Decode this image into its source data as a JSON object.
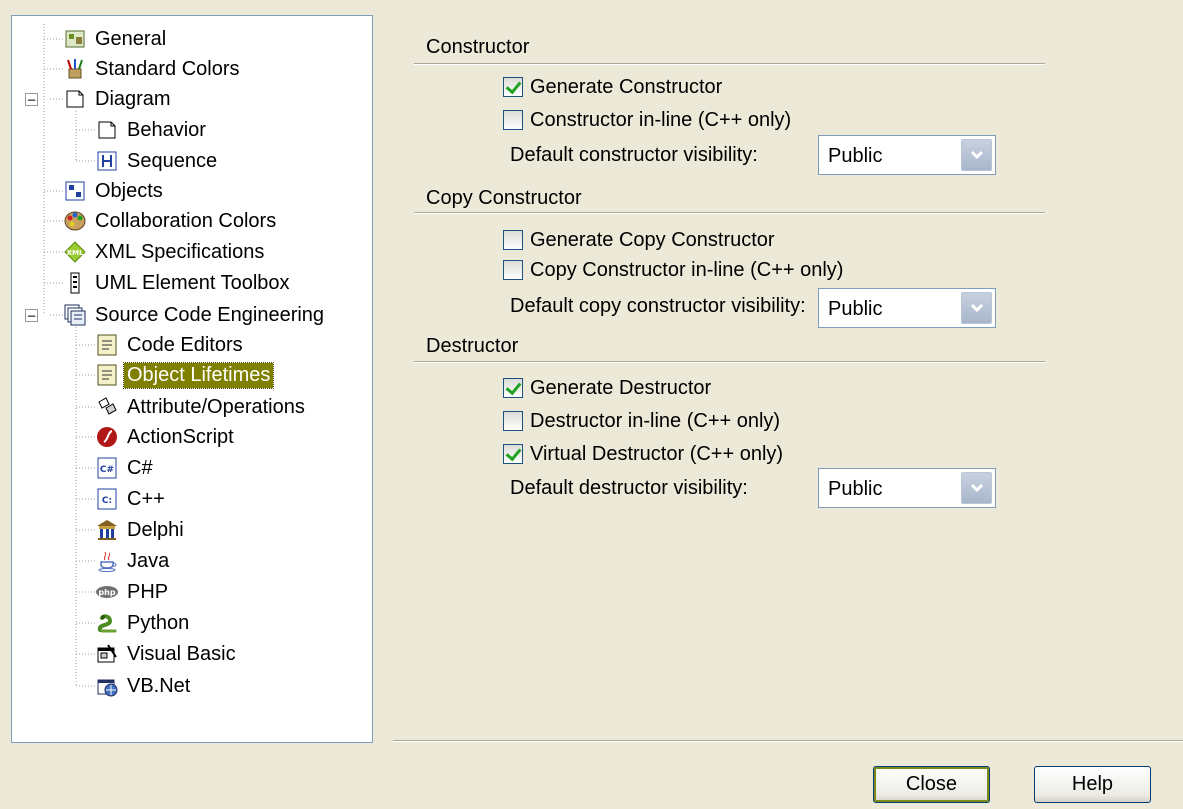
{
  "tree": {
    "items": [
      {
        "label": "General",
        "icon": "general-icon"
      },
      {
        "label": "Standard Colors",
        "icon": "paint-brushes-icon"
      },
      {
        "label": "Diagram",
        "icon": "diagram-page-icon"
      },
      {
        "label": "Behavior",
        "icon": "page-icon"
      },
      {
        "label": "Sequence",
        "icon": "sequence-icon"
      },
      {
        "label": "Objects",
        "icon": "objects-icon"
      },
      {
        "label": "Collaboration Colors",
        "icon": "palette-icon"
      },
      {
        "label": "XML Specifications",
        "icon": "xml-icon"
      },
      {
        "label": "UML Element Toolbox",
        "icon": "toolbox-icon"
      },
      {
        "label": "Source Code Engineering",
        "icon": "source-code-icon"
      },
      {
        "label": "Code Editors",
        "icon": "code-editor-icon"
      },
      {
        "label": "Object Lifetimes",
        "icon": "code-editor-icon"
      },
      {
        "label": "Attribute/Operations",
        "icon": "attribute-operations-icon"
      },
      {
        "label": "ActionScript",
        "icon": "actionscript-icon"
      },
      {
        "label": "C#",
        "icon": "csharp-icon"
      },
      {
        "label": "C++",
        "icon": "cplusplus-icon"
      },
      {
        "label": "Delphi",
        "icon": "delphi-icon"
      },
      {
        "label": "Java",
        "icon": "java-icon"
      },
      {
        "label": "PHP",
        "icon": "php-icon"
      },
      {
        "label": "Python",
        "icon": "python-icon"
      },
      {
        "label": "Visual Basic",
        "icon": "visual-basic-icon"
      },
      {
        "label": "VB.Net",
        "icon": "vbnet-icon"
      }
    ],
    "selected": "Object Lifetimes",
    "expander_symbols": {
      "expanded": "−"
    }
  },
  "constructor": {
    "title": "Constructor",
    "generate_label": "Generate Constructor",
    "generate_checked": true,
    "inline_label": "Constructor in-line (C++ only)",
    "inline_checked": false,
    "visibility_label": "Default constructor visibility:",
    "visibility_value": "Public"
  },
  "copy_constructor": {
    "title": "Copy Constructor",
    "generate_label": "Generate Copy Constructor",
    "generate_checked": false,
    "inline_label": "Copy Constructor in-line (C++ only)",
    "inline_checked": false,
    "visibility_label": "Default copy constructor visibility:",
    "visibility_value": "Public"
  },
  "destructor": {
    "title": "Destructor",
    "generate_label": "Generate Destructor",
    "generate_checked": true,
    "inline_label": "Destructor in-line (C++ only)",
    "inline_checked": false,
    "virtual_label": "Virtual Destructor (C++ only)",
    "virtual_checked": true,
    "visibility_label": "Default destructor visibility:",
    "visibility_value": "Public"
  },
  "buttons": {
    "close_label": "Close",
    "help_label": "Help"
  },
  "colors": {
    "selection": "#808000",
    "check": "#21A121",
    "default_button_ring": "#7D8B1A"
  }
}
